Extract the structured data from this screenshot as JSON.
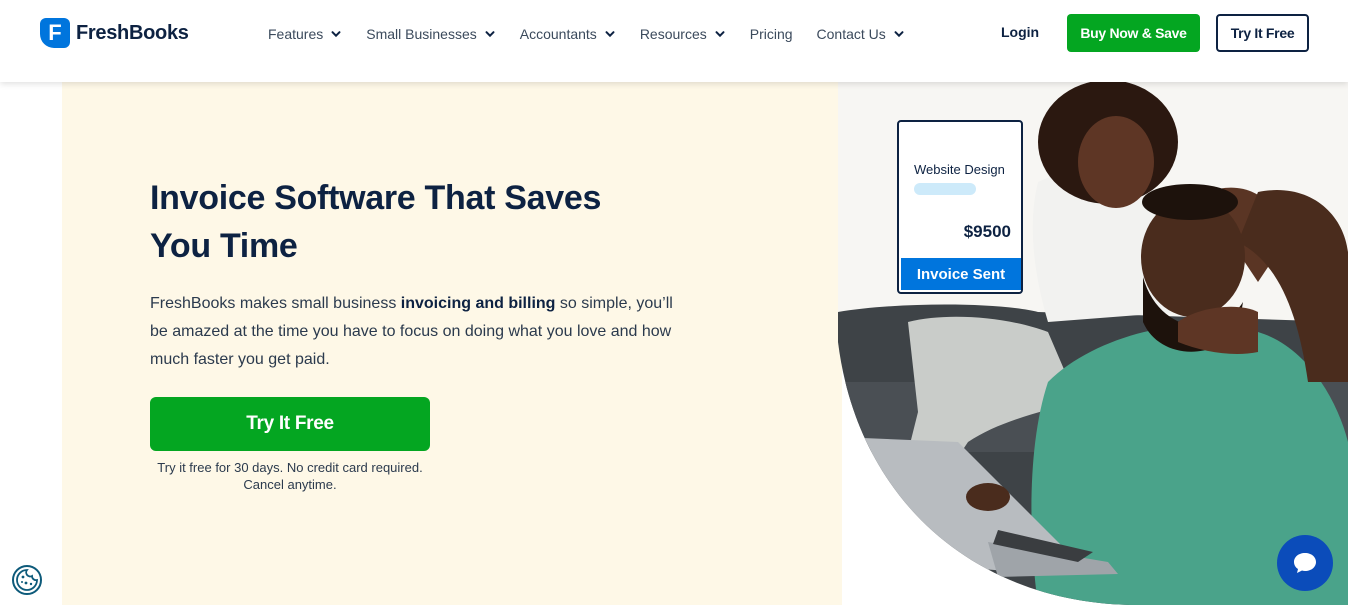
{
  "brand": {
    "logo_letter": "F",
    "name": "FreshBooks",
    "primary_color": "#0075dd",
    "accent_green": "#04a621",
    "navy": "#0d2242"
  },
  "nav": {
    "items": [
      {
        "label": "Features",
        "has_dropdown": true
      },
      {
        "label": "Small Businesses",
        "has_dropdown": true
      },
      {
        "label": "Accountants",
        "has_dropdown": true
      },
      {
        "label": "Resources",
        "has_dropdown": true
      },
      {
        "label": "Pricing",
        "has_dropdown": false
      },
      {
        "label": "Contact Us",
        "has_dropdown": true
      }
    ],
    "login_label": "Login",
    "buy_label": "Buy Now & Save",
    "try_label": "Try It Free"
  },
  "hero": {
    "title": "Invoice Software That Saves You Time",
    "desc_before": "FreshBooks makes small business ",
    "desc_bold": "invoicing and billing",
    "desc_after": " so simple, you’ll be amazed at the time you have to focus on doing what you love and how much faster you get paid.",
    "cta_label": "Try It Free",
    "cta_note": "Try it free for 30 days. No credit card required. Cancel anytime."
  },
  "invoice_card": {
    "label": "Website Design",
    "amount": "$9500",
    "status": "Invoice Sent"
  },
  "widgets": {
    "cookie_icon": "cookie-icon",
    "chat_icon": "chat-bubble-icon"
  }
}
